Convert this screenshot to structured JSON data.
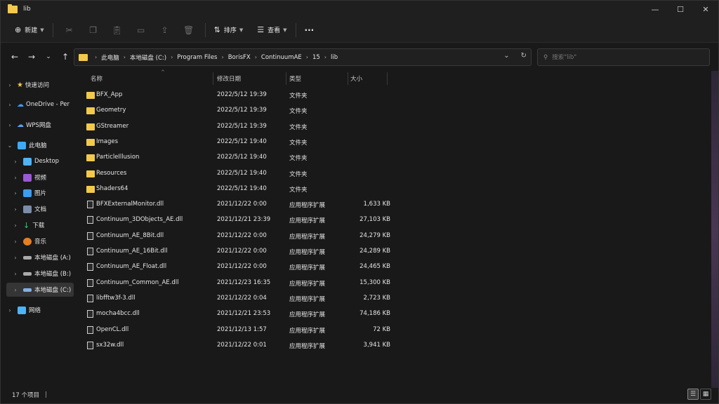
{
  "window": {
    "title": "lib"
  },
  "toolbar": {
    "new_label": "新建",
    "sort_label": "排序",
    "view_label": "查看",
    "more_label": "···"
  },
  "address": {
    "crumbs": [
      "此电脑",
      "本地磁盘 (C:)",
      "Program Files",
      "BorisFX",
      "ContinuumAE",
      "15",
      "lib"
    ]
  },
  "search": {
    "placeholder": "搜索\"lib\""
  },
  "sidebar": {
    "items": [
      {
        "label": "快速访问",
        "icon": "star-icon",
        "color": "#f2c94c"
      },
      {
        "label": "OneDrive - Per",
        "icon": "cloud-icon",
        "color": "#3b9cf0"
      },
      {
        "label": "WPS网盘",
        "icon": "cloud-icon",
        "color": "#5aa0f5"
      },
      {
        "label": "此电脑",
        "icon": "computer-icon",
        "color": "#3fa9f5"
      },
      {
        "label": "Desktop",
        "icon": "desktop-icon",
        "color": "#4fb3f7"
      },
      {
        "label": "视频",
        "icon": "video-icon",
        "color": "#9b59d6"
      },
      {
        "label": "图片",
        "icon": "picture-icon",
        "color": "#3b9cf0"
      },
      {
        "label": "文档",
        "icon": "document-icon",
        "color": "#7a8ca8"
      },
      {
        "label": "下载",
        "icon": "download-icon",
        "color": "#2ecc71"
      },
      {
        "label": "音乐",
        "icon": "music-icon",
        "color": "#e67e22"
      },
      {
        "label": "本地磁盘 (A:)",
        "icon": "drive-icon",
        "color": "#aaaaaa"
      },
      {
        "label": "本地磁盘 (B:)",
        "icon": "drive-icon",
        "color": "#aaaaaa"
      },
      {
        "label": "本地磁盘 (C:)",
        "icon": "drive-icon",
        "color": "#7fb2e8"
      },
      {
        "label": "网络",
        "icon": "network-icon",
        "color": "#4fb3f7"
      }
    ]
  },
  "columns": {
    "name": "名称",
    "date": "修改日期",
    "type": "类型",
    "size": "大小"
  },
  "files": [
    {
      "name": "BFX_App",
      "date": "2022/5/12 19:39",
      "type": "文件夹",
      "size": "",
      "kind": "folder"
    },
    {
      "name": "Geometry",
      "date": "2022/5/12 19:39",
      "type": "文件夹",
      "size": "",
      "kind": "folder"
    },
    {
      "name": "GStreamer",
      "date": "2022/5/12 19:39",
      "type": "文件夹",
      "size": "",
      "kind": "folder"
    },
    {
      "name": "Images",
      "date": "2022/5/12 19:40",
      "type": "文件夹",
      "size": "",
      "kind": "folder"
    },
    {
      "name": "ParticleIllusion",
      "date": "2022/5/12 19:40",
      "type": "文件夹",
      "size": "",
      "kind": "folder"
    },
    {
      "name": "Resources",
      "date": "2022/5/12 19:40",
      "type": "文件夹",
      "size": "",
      "kind": "folder"
    },
    {
      "name": "Shaders64",
      "date": "2022/5/12 19:40",
      "type": "文件夹",
      "size": "",
      "kind": "folder"
    },
    {
      "name": "BFXExternalMonitor.dll",
      "date": "2021/12/22 0:00",
      "type": "应用程序扩展",
      "size": "1,633 KB",
      "kind": "file"
    },
    {
      "name": "Continuum_3DObjects_AE.dll",
      "date": "2021/12/21 23:39",
      "type": "应用程序扩展",
      "size": "27,103 KB",
      "kind": "file"
    },
    {
      "name": "Continuum_AE_8Bit.dll",
      "date": "2021/12/22 0:00",
      "type": "应用程序扩展",
      "size": "24,279 KB",
      "kind": "file"
    },
    {
      "name": "Continuum_AE_16Bit.dll",
      "date": "2021/12/22 0:00",
      "type": "应用程序扩展",
      "size": "24,289 KB",
      "kind": "file"
    },
    {
      "name": "Continuum_AE_Float.dll",
      "date": "2021/12/22 0:00",
      "type": "应用程序扩展",
      "size": "24,465 KB",
      "kind": "file"
    },
    {
      "name": "Continuum_Common_AE.dll",
      "date": "2021/12/23 16:35",
      "type": "应用程序扩展",
      "size": "15,300 KB",
      "kind": "file"
    },
    {
      "name": "libfftw3f-3.dll",
      "date": "2021/12/22 0:04",
      "type": "应用程序扩展",
      "size": "2,723 KB",
      "kind": "file"
    },
    {
      "name": "mocha4bcc.dll",
      "date": "2021/12/21 23:53",
      "type": "应用程序扩展",
      "size": "74,186 KB",
      "kind": "file"
    },
    {
      "name": "OpenCL.dll",
      "date": "2021/12/13 1:57",
      "type": "应用程序扩展",
      "size": "72 KB",
      "kind": "file"
    },
    {
      "name": "sx32w.dll",
      "date": "2021/12/22 0:01",
      "type": "应用程序扩展",
      "size": "3,941 KB",
      "kind": "file"
    }
  ],
  "status": {
    "count": "17 个项目",
    "sep": "|"
  }
}
